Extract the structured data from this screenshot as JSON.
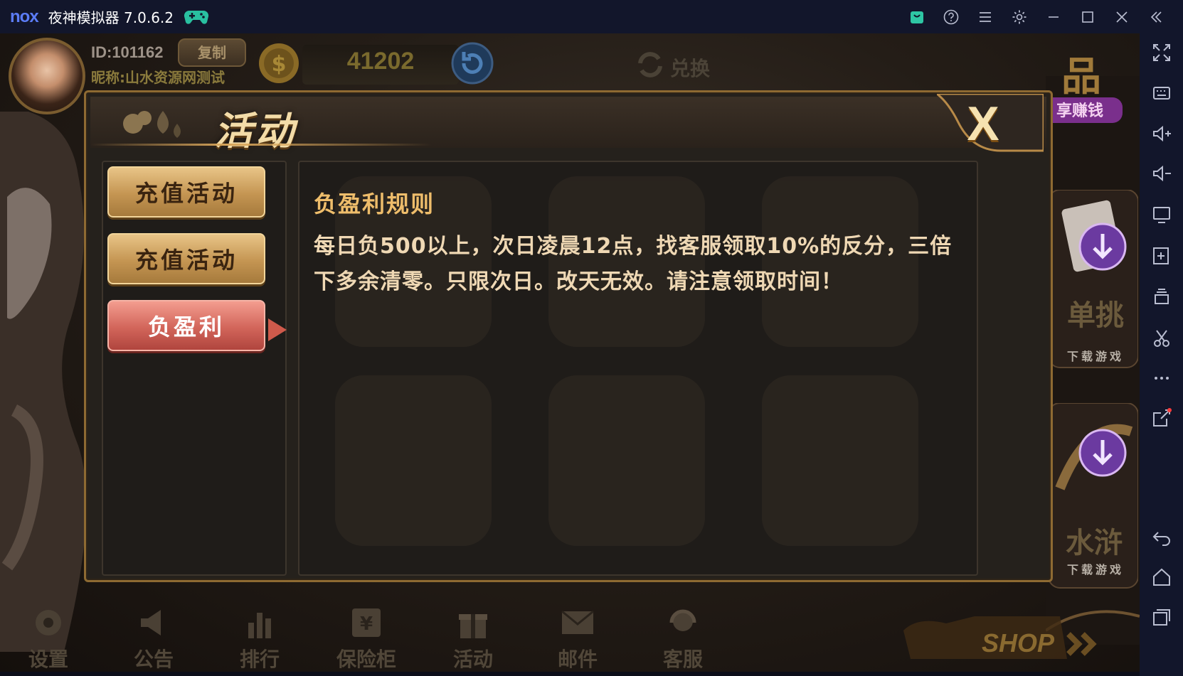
{
  "window": {
    "logo": "nox",
    "title": "夜神模拟器 7.0.6.2"
  },
  "player": {
    "id": "ID:101162",
    "copy_label": "复制",
    "nickname": "昵称:山水资源网测试",
    "coins": "41202"
  },
  "header": {
    "exchange_label": "兑换"
  },
  "dialog": {
    "title": "活动",
    "close_label": "X",
    "menu": [
      {
        "label": "充值活动",
        "state": "normal"
      },
      {
        "label": "充值活动",
        "state": "normal"
      },
      {
        "label": "负盈利",
        "state": "active"
      }
    ],
    "content": {
      "title": "负盈利规则",
      "body": "每日负500以上，次日凌晨12点，找客服领取10%的反分，三倍下多余清零。只限次日。改天无效。请注意领取时间！"
    }
  },
  "bottom_nav": [
    {
      "label": "设置",
      "icon": "gear-icon"
    },
    {
      "label": "公告",
      "icon": "megaphone-icon"
    },
    {
      "label": "排行",
      "icon": "bar-chart-icon"
    },
    {
      "label": "保险柜",
      "icon": "safe-icon"
    },
    {
      "label": "活动",
      "icon": "gift-icon"
    },
    {
      "label": "邮件",
      "icon": "mail-icon"
    },
    {
      "label": "客服",
      "icon": "headset-icon"
    }
  ],
  "promo": {
    "top_right_text": "享赚钱",
    "card1_download": "下载游戏",
    "card2_download": "下载游戏",
    "shop_label": "SHOP"
  },
  "colors": {
    "accent_gold": "#e8c487",
    "active_red": "#d2655a",
    "rule_title": "#eebd6b",
    "emulator_bar": "#12162b"
  }
}
